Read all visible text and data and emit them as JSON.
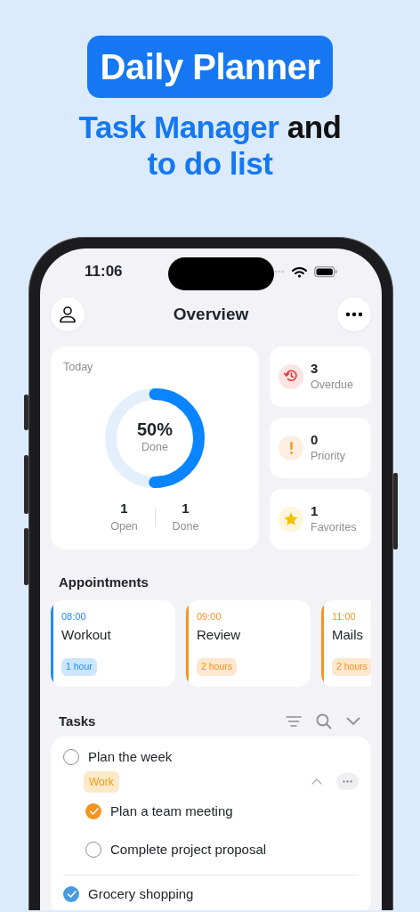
{
  "promo": {
    "badge": "Daily Planner",
    "subtitle_lines": [
      [
        {
          "text": "Task Manager",
          "accent": true
        },
        {
          "text": " and",
          "accent": false
        }
      ],
      [
        {
          "text": "to do list",
          "accent": true
        }
      ]
    ]
  },
  "status_bar": {
    "time": "11:06"
  },
  "nav": {
    "title": "Overview"
  },
  "today": {
    "label": "Today",
    "percent": "50%",
    "percent_label": "Done",
    "level": 0.5,
    "counts": [
      {
        "value": "1",
        "label": "Open"
      },
      {
        "value": "1",
        "label": "Done"
      }
    ]
  },
  "stats": [
    {
      "kind": "overdue",
      "value": "3",
      "label": "Overdue"
    },
    {
      "kind": "priority",
      "value": "0",
      "label": "Priority"
    },
    {
      "kind": "favorites",
      "value": "1",
      "label": "Favorites"
    }
  ],
  "appointments": {
    "title": "Appointments",
    "items": [
      {
        "time": "08:00",
        "title": "Workout",
        "duration": "1 hour",
        "color": "#1a8cff"
      },
      {
        "time": "09:00",
        "title": "Review",
        "duration": "2 hours",
        "color": "#f7931e"
      },
      {
        "time": "11:00",
        "title": "Mails",
        "duration": "2 hours",
        "color": "#f7931e"
      }
    ]
  },
  "tasks": {
    "title": "Tasks",
    "items": [
      {
        "title": "Plan the week",
        "checked": false,
        "tag": "Work",
        "expanded": true,
        "children": [
          {
            "title": "Plan a team meeting",
            "checked": true,
            "color": "#f7931e"
          },
          {
            "title": "Complete project proposal",
            "checked": false
          }
        ]
      },
      {
        "title": "Grocery shopping",
        "checked": true,
        "color": "#4a9be0"
      }
    ]
  }
}
